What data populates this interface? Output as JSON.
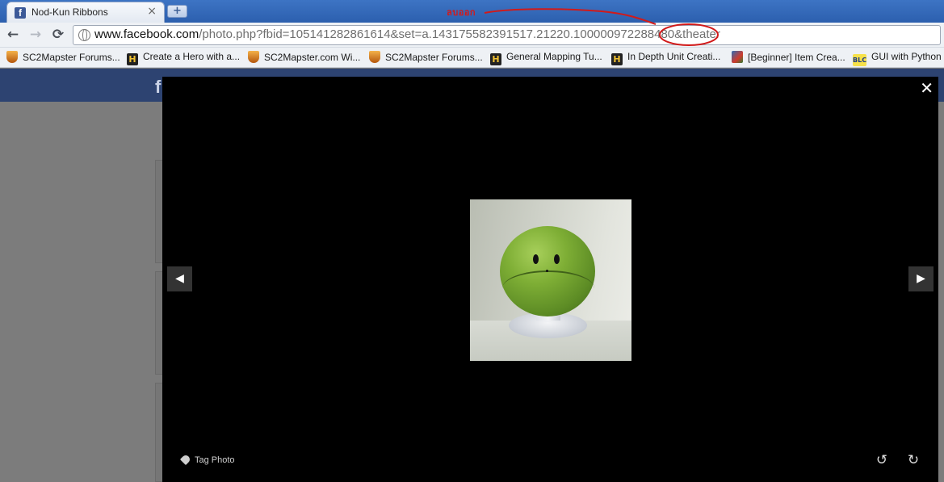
{
  "browser": {
    "tab": {
      "favicon": "facebook-icon",
      "title": "Nod-Kun Ribbons",
      "close": "×"
    },
    "new_tab": "+",
    "nav": {
      "back": "←",
      "forward": "→",
      "reload": "⟳"
    },
    "url": {
      "host": "www.facebook.com",
      "path": "/photo.php?fbid=105141282861614&set=a.143175582391517.21220.100000972288480&theater"
    },
    "annotation": {
      "text": "ลบออก",
      "color": "#d11a1a"
    },
    "bookmarks": [
      {
        "icon": "sc2mapster-shield-icon",
        "label": "SC2Mapster Forums..."
      },
      {
        "icon": "hive-h-icon",
        "label": "Create a Hero with a..."
      },
      {
        "icon": "sc2mapster-shield-icon",
        "label": "SC2Mapster.com Wi..."
      },
      {
        "icon": "sc2mapster-shield-icon",
        "label": "SC2Mapster Forums..."
      },
      {
        "icon": "hive-h-icon",
        "label": "General Mapping Tu..."
      },
      {
        "icon": "hive-h-icon",
        "label": "In Depth Unit Creati..."
      },
      {
        "icon": "game-icon",
        "label": "[Beginner] Item Crea..."
      },
      {
        "icon": "blc-icon",
        "label": "GUI with Python o"
      }
    ]
  },
  "facebook": {
    "logo": "f",
    "theater": {
      "close": "✕",
      "prev": "◀",
      "next": "▶",
      "tag_photo": "Tag Photo",
      "rotate_left": "↺",
      "rotate_right": "↻",
      "photo_subject": "green-haro-ball-figure"
    }
  },
  "colors": {
    "facebook_blue": "#2d4371",
    "theater_bg": "#000000",
    "overlay_gray": "#7c7c7c",
    "annotation_red": "#d11a1a"
  }
}
